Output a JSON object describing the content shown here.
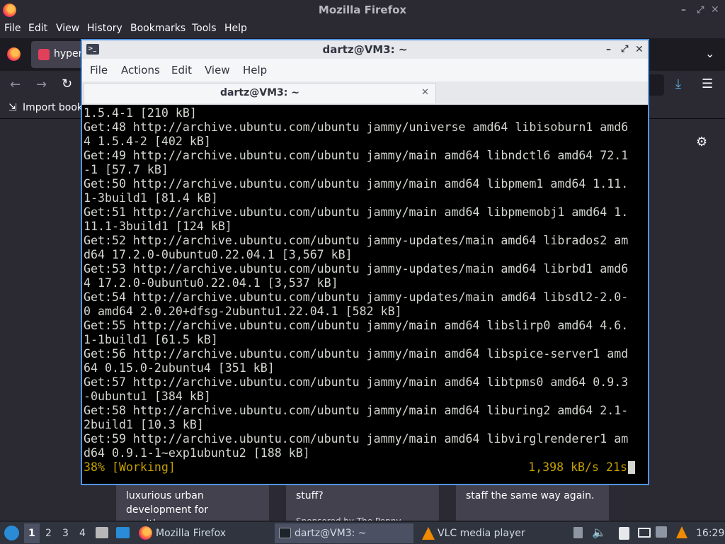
{
  "firefox": {
    "window_title": "Mozilla Firefox",
    "menu": [
      "File",
      "Edit",
      "View",
      "History",
      "Bookmarks",
      "Tools",
      "Help"
    ],
    "tab_label": "hyper",
    "bookmarks_label": "Import book",
    "cards": [
      {
        "text": "luxurious urban development for wealthy…"
      },
      {
        "text": "stuff?",
        "sponsor": "Sponsored by The Penny"
      },
      {
        "text": "staff the same way again."
      }
    ]
  },
  "terminal": {
    "title": "dartz@VM3: ~",
    "menu": [
      "File",
      "Actions",
      "Edit",
      "View",
      "Help"
    ],
    "tab_title": "dartz@VM3: ~",
    "lines": [
      "1.5.4-1 [210 kB]",
      "Get:48 http://archive.ubuntu.com/ubuntu jammy/universe amd64 libisoburn1 amd6",
      "4 1.5.4-2 [402 kB]",
      "Get:49 http://archive.ubuntu.com/ubuntu jammy/main amd64 libndctl6 amd64 72.1",
      "-1 [57.7 kB]",
      "Get:50 http://archive.ubuntu.com/ubuntu jammy/main amd64 libpmem1 amd64 1.11.",
      "1-3build1 [81.4 kB]",
      "Get:51 http://archive.ubuntu.com/ubuntu jammy/main amd64 libpmemobj1 amd64 1.",
      "11.1-3build1 [124 kB]",
      "Get:52 http://archive.ubuntu.com/ubuntu jammy-updates/main amd64 librados2 am",
      "d64 17.2.0-0ubuntu0.22.04.1 [3,567 kB]",
      "Get:53 http://archive.ubuntu.com/ubuntu jammy-updates/main amd64 librbd1 amd6",
      "4 17.2.0-0ubuntu0.22.04.1 [3,537 kB]",
      "Get:54 http://archive.ubuntu.com/ubuntu jammy-updates/main amd64 libsdl2-2.0-",
      "0 amd64 2.0.20+dfsg-2ubuntu1.22.04.1 [582 kB]",
      "Get:55 http://archive.ubuntu.com/ubuntu jammy/main amd64 libslirp0 amd64 4.6.",
      "1-1build1 [61.5 kB]",
      "Get:56 http://archive.ubuntu.com/ubuntu jammy/main amd64 libspice-server1 amd",
      "64 0.15.0-2ubuntu4 [351 kB]",
      "Get:57 http://archive.ubuntu.com/ubuntu jammy/main amd64 libtpms0 amd64 0.9.3",
      "-0ubuntu1 [384 kB]",
      "Get:58 http://archive.ubuntu.com/ubuntu jammy/main amd64 liburing2 amd64 2.1-",
      "2build1 [10.3 kB]",
      "Get:59 http://archive.ubuntu.com/ubuntu jammy/main amd64 libvirglrenderer1 am",
      "d64 0.9.1-1~exp1ubuntu2 [188 kB]"
    ],
    "status_left": "38% [Working]",
    "status_right": "1,398 kB/s 21s"
  },
  "taskbar": {
    "workspaces": [
      "1",
      "2",
      "3",
      "4"
    ],
    "tasks": [
      "Mozilla Firefox",
      "dartz@VM3: ~",
      "VLC media player"
    ],
    "clock": "16:29"
  },
  "colors": {
    "accent": "#5294e2",
    "terminal_bg": "#000000",
    "status_text": "#c4a000"
  }
}
